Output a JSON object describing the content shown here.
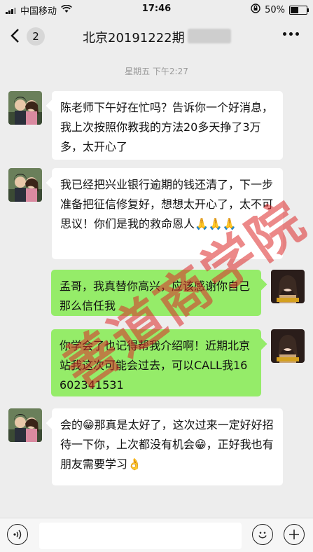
{
  "status_bar": {
    "carrier": "中国移动",
    "time": "17:46",
    "battery": "50%"
  },
  "nav": {
    "unread_count": "2",
    "title": "北京20191222期"
  },
  "timestamp": "星期五 下午2:27",
  "messages": [
    {
      "side": "in",
      "text": "陈老师下午好在忙吗？告诉你一个好消息，我上次按照你教我的方法20多天挣了3万多，太开心了"
    },
    {
      "side": "in",
      "text": "我已经把兴业银行逾期的钱还清了，下一步准备把征信修复好，想想太开心了，太不可思议！你们是我的救命恩人🙏🙏🙏"
    },
    {
      "side": "out",
      "text": "孟哥，我真替你高兴，应该感谢你自己那么信任我"
    },
    {
      "side": "out",
      "text": "你学会了也记得帮我介绍啊！近期北京站我这次可能会过去，可以CALL我16602341531"
    },
    {
      "side": "in",
      "text": "会的😁那真是太好了，这次过来一定好好招待一下你，上次都没有机会😁，正好我也有朋友需要学习👌"
    }
  ],
  "watermark": "善道商学院",
  "colors": {
    "outgoing_bubble": "#95ec69",
    "incoming_bubble": "#ffffff",
    "background": "#ededed"
  }
}
